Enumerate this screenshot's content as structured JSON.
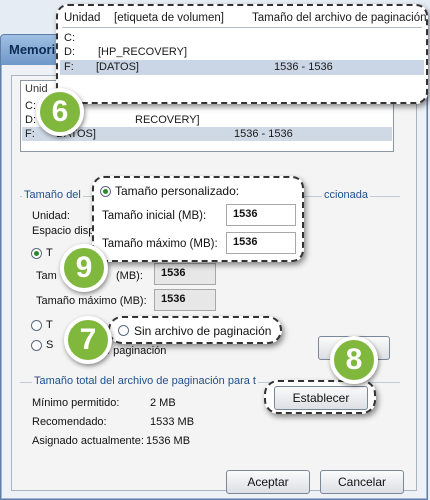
{
  "window": {
    "title": "Memoria virtual"
  },
  "top_list": {
    "columns": [
      "Unidad",
      "[etiqueta de volumen]",
      "Tamaño del archivo de paginación"
    ],
    "rows": [
      {
        "drive": "C:",
        "label": "",
        "size": ""
      },
      {
        "drive": "D:",
        "label": "[HP_RECOVERY]",
        "size": ""
      },
      {
        "drive": "F:",
        "label": "[DATOS]",
        "size": "1536 - 1536"
      }
    ]
  },
  "bg_list": {
    "header": "Unid",
    "rows": [
      {
        "drive": "C:",
        "label": "",
        "size": ""
      },
      {
        "drive": "D:",
        "label": "RECOVERY]",
        "size": ""
      },
      {
        "drive": "F:",
        "label": "DATOS]",
        "size": "1536 - 1536"
      }
    ]
  },
  "drive_group": {
    "title": "Tamaño del",
    "title_tail": "ccionada",
    "unit_label": "Unidad:",
    "space_label": "Espacio disp",
    "custom_label_short": "T",
    "initial_short": "Tam",
    "initial_unit": "(MB):",
    "initial_value": "1536",
    "max_label": "Tamaño máximo (MB):",
    "max_value": "1536",
    "system_label_short": "T",
    "none_label_short": "S",
    "none_tail": "e paginación"
  },
  "callout_custom": {
    "option_label": "Tamaño personalizado:",
    "initial_label": "Tamaño inicial (MB):",
    "initial_value": "1536",
    "max_label": "Tamaño máximo (MB):",
    "max_value": "1536"
  },
  "callout_none": {
    "option_label": "Sin archivo de paginación"
  },
  "set_button": {
    "label": "Establecer",
    "bg_label": "E"
  },
  "total_group": {
    "title": "Tamaño total del archivo de paginación para t",
    "min_label": "Mínimo permitido:",
    "min_value": "2 MB",
    "rec_label": "Recomendado:",
    "rec_value": "1533 MB",
    "assigned_label": "Asignado actualmente:",
    "assigned_value": "1536 MB"
  },
  "footer": {
    "ok_label": "Aceptar",
    "cancel_label": "Cancelar"
  },
  "steps": {
    "six": "6",
    "seven": "7",
    "eight": "8",
    "nine": "9"
  },
  "colors": {
    "badge": "#7fb83d",
    "accent": "#1e4f8f",
    "titlebar": "#6f98c8"
  }
}
